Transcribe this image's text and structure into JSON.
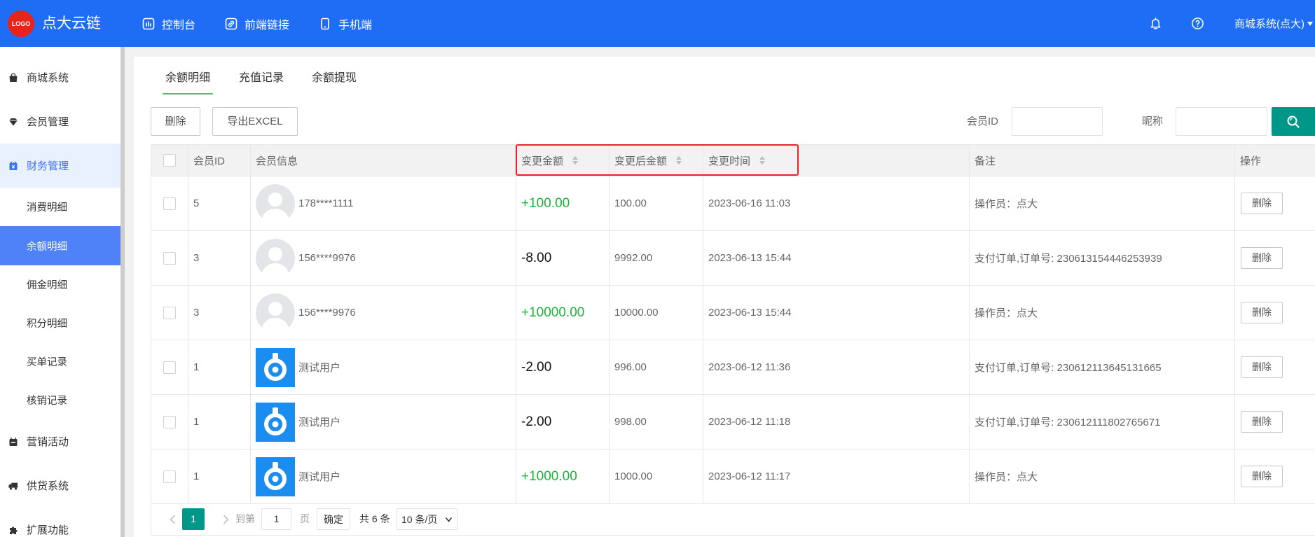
{
  "brand": {
    "logo_text": "LOGO",
    "name": "点大云链"
  },
  "top_nav": [
    {
      "label": "控制台",
      "icon": "dashboard-icon"
    },
    {
      "label": "前端链接",
      "icon": "link-icon"
    },
    {
      "label": "手机端",
      "icon": "mobile-icon"
    }
  ],
  "header_right": {
    "notification_icon": "bell-icon",
    "help_icon": "help-icon",
    "account": "商城系统(点大)"
  },
  "sidebar": {
    "items": [
      {
        "label": "商城系统",
        "icon": "shop-bag-icon"
      },
      {
        "label": "会员管理",
        "icon": "diamond-icon"
      },
      {
        "label": "财务管理",
        "icon": "finance-icon",
        "expanded": true,
        "children": [
          {
            "label": "消费明细"
          },
          {
            "label": "余额明细",
            "active": true
          },
          {
            "label": "佣金明细"
          },
          {
            "label": "积分明细"
          },
          {
            "label": "买单记录"
          },
          {
            "label": "核销记录"
          }
        ]
      },
      {
        "label": "营销活动",
        "icon": "marketing-icon"
      },
      {
        "label": "供货系统",
        "icon": "truck-icon"
      },
      {
        "label": "扩展功能",
        "icon": "puzzle-icon"
      }
    ]
  },
  "tabs": [
    {
      "label": "余额明细",
      "active": true
    },
    {
      "label": "充值记录"
    },
    {
      "label": "余额提现"
    }
  ],
  "toolbar": {
    "delete_label": "删除",
    "export_label": "导出EXCEL"
  },
  "filters": {
    "member_id_label": "会员ID",
    "nickname_label": "昵称",
    "search_icon": "search-icon"
  },
  "table": {
    "columns": [
      "会员ID",
      "会员信息",
      "变更金额",
      "变更后金额",
      "变更时间",
      "备注",
      "操作"
    ],
    "sortable_columns": [
      "变更金额",
      "变更后金额",
      "变更时间"
    ],
    "rows": [
      {
        "member_id": "5",
        "avatar": "default-avatar-icon",
        "name": "178****1111",
        "amount": "+100.00",
        "balance_after": "100.00",
        "time": "2023-06-16 11:03",
        "remark": "操作员：点大",
        "action": "删除"
      },
      {
        "member_id": "3",
        "avatar": "default-avatar-icon",
        "name": "156****9976",
        "amount": "-8.00",
        "balance_after": "9992.00",
        "time": "2023-06-13 15:44",
        "remark": "支付订单,订单号: 230613154446253939",
        "action": "删除"
      },
      {
        "member_id": "3",
        "avatar": "default-avatar-icon",
        "name": "156****9976",
        "amount": "+10000.00",
        "balance_after": "10000.00",
        "time": "2023-06-13 15:44",
        "remark": "操作员：点大",
        "action": "删除"
      },
      {
        "member_id": "1",
        "avatar": "app-logo-avatar-icon",
        "name": "测试用户",
        "amount": "-2.00",
        "balance_after": "996.00",
        "time": "2023-06-12 11:36",
        "remark": "支付订单,订单号: 230612113645131665",
        "action": "删除"
      },
      {
        "member_id": "1",
        "avatar": "app-logo-avatar-icon",
        "name": "测试用户",
        "amount": "-2.00",
        "balance_after": "998.00",
        "time": "2023-06-12 11:18",
        "remark": "支付订单,订单号: 230612111802765671",
        "action": "删除"
      },
      {
        "member_id": "1",
        "avatar": "app-logo-avatar-icon",
        "name": "测试用户",
        "amount": "+1000.00",
        "balance_after": "1000.00",
        "time": "2023-06-12 11:17",
        "remark": "操作员：点大",
        "action": "删除"
      }
    ]
  },
  "pagination": {
    "current_page": "1",
    "goto_prefix": "到第",
    "goto_value": "1",
    "goto_suffix": "页",
    "confirm_label": "确定",
    "total_text": "共 6 条",
    "page_size": "10 条/页"
  },
  "colors": {
    "header_bg": "#1f6df4",
    "teal_accent": "#009688",
    "tab_underline": "#5fb878",
    "positive_amount": "#1db33a",
    "highlight_border": "#e3262a",
    "sidebar_active_bg": "#4f82f7",
    "sidebar_group_bg": "#e9f0fe"
  }
}
